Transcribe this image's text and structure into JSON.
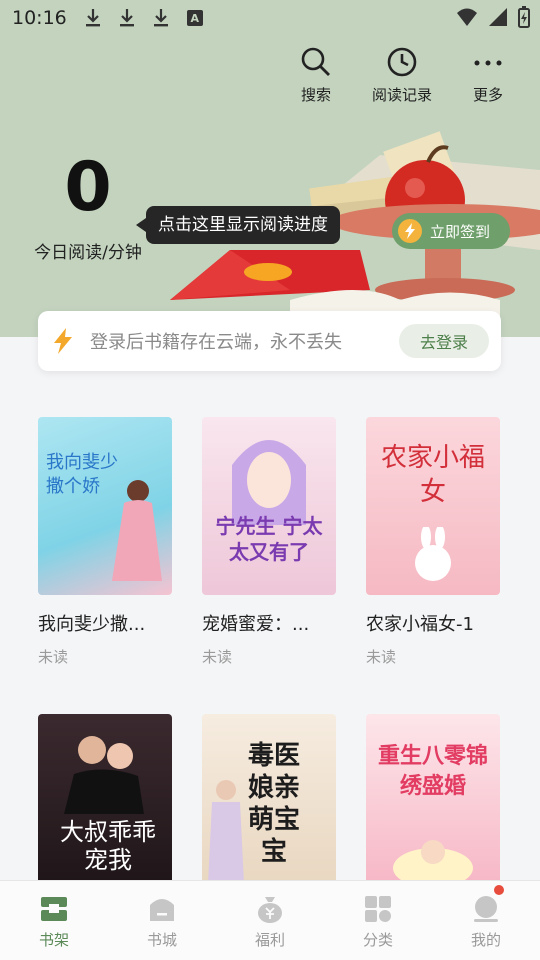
{
  "status": {
    "time": "10:16",
    "a_label": "A"
  },
  "top_actions": [
    {
      "label": "搜索",
      "icon": "search-icon"
    },
    {
      "label": "阅读记录",
      "icon": "clock-icon"
    },
    {
      "label": "更多",
      "icon": "more-icon"
    }
  ],
  "reading": {
    "minutes": "0",
    "label": "今日阅读/分钟"
  },
  "tooltip": "点击这里显示阅读进度",
  "checkin": {
    "label": "立即签到"
  },
  "login": {
    "text": "登录后书籍存在云端，永不丢失",
    "button": "去登录"
  },
  "books": [
    {
      "title": "我向斐少撒...",
      "status": "未读",
      "cover_text": "我向斐少撒个娇",
      "cover_color": "#8fd9ea"
    },
    {
      "title": "宠婚蜜爱：...",
      "status": "未读",
      "cover_text": "宁先生 宁太太又有了",
      "cover_color": "#f6d7e3"
    },
    {
      "title": "农家小福女-1",
      "status": "未读",
      "cover_text": "农家小福女",
      "cover_color": "#f8c7cd"
    },
    {
      "title": "",
      "status": "",
      "cover_text": "大叔乖乖宠我",
      "cover_color": "#2b2024"
    },
    {
      "title": "",
      "status": "",
      "cover_text": "毒医娘亲 萌宝宝",
      "cover_color": "#eedfca"
    },
    {
      "title": "",
      "status": "",
      "cover_text": "重生八零锦绣盛婚",
      "cover_color": "#f7b8c7"
    }
  ],
  "nav": [
    {
      "label": "书架",
      "active": true
    },
    {
      "label": "书城",
      "active": false
    },
    {
      "label": "福利",
      "active": false
    },
    {
      "label": "分类",
      "active": false
    },
    {
      "label": "我的",
      "active": false
    }
  ],
  "colors": {
    "accent": "#5b8a58",
    "hero_bg": "#c3d3be",
    "tooltip_bg": "#262626"
  }
}
